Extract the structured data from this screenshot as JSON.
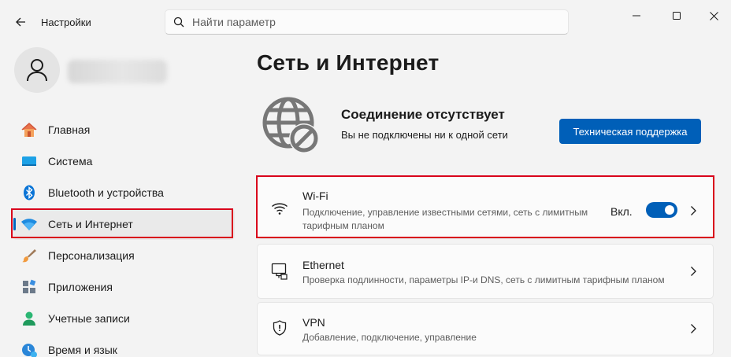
{
  "window": {
    "app_title": "Настройки"
  },
  "search": {
    "placeholder": "Найти параметр",
    "value": ""
  },
  "sidebar": {
    "items": [
      {
        "label": "Главная",
        "icon": "home-icon",
        "selected": false
      },
      {
        "label": "Система",
        "icon": "system-icon",
        "selected": false
      },
      {
        "label": "Bluetooth и устройства",
        "icon": "bluetooth-icon",
        "selected": false
      },
      {
        "label": "Сеть и Интернет",
        "icon": "network-icon",
        "selected": true
      },
      {
        "label": "Персонализация",
        "icon": "brush-icon",
        "selected": false
      },
      {
        "label": "Приложения",
        "icon": "apps-icon",
        "selected": false
      },
      {
        "label": "Учетные записи",
        "icon": "accounts-icon",
        "selected": false
      },
      {
        "label": "Время и язык",
        "icon": "time-language-icon",
        "selected": false
      }
    ]
  },
  "main": {
    "title": "Сеть и Интернет",
    "status": {
      "title": "Соединение отсутствует",
      "subtitle": "Вы не подключены ни к одной сети",
      "support_button": "Техническая поддержка"
    },
    "cards": {
      "wifi": {
        "title": "Wi-Fi",
        "subtitle_line1": "Подключение, управление известными сетями, сеть с лимитным",
        "subtitle_line2": "тарифным планом",
        "toggle_label": "Вкл.",
        "toggle_on": true
      },
      "ethernet": {
        "title": "Ethernet",
        "subtitle": "Проверка подлинности, параметры IP-и DNS, сеть с лимитным тарифным планом"
      },
      "vpn": {
        "title": "VPN",
        "subtitle": "Добавление, подключение, управление"
      }
    }
  },
  "colors": {
    "accent": "#005fb8",
    "highlight": "#d9001b",
    "background": "#f3f3f3",
    "card": "#fbfbfb"
  }
}
